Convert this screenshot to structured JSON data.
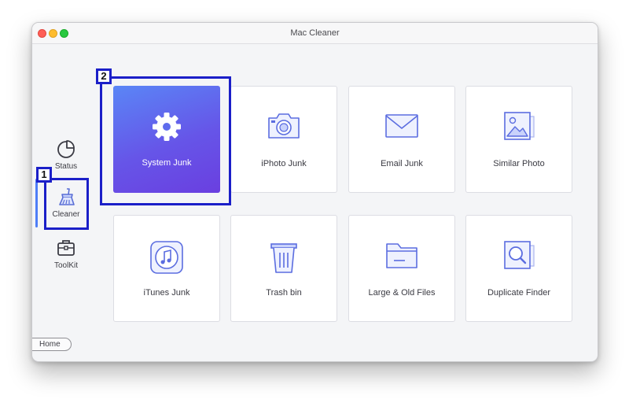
{
  "window": {
    "title": "Mac Cleaner"
  },
  "sidebar": {
    "items": [
      {
        "label": "Status",
        "icon": "pie-chart-icon"
      },
      {
        "label": "Cleaner",
        "icon": "broom-icon"
      },
      {
        "label": "ToolKit",
        "icon": "toolbox-icon"
      }
    ],
    "home_label": "Home"
  },
  "tiles": [
    {
      "label": "System Junk",
      "icon": "gear-icon"
    },
    {
      "label": "iPhoto Junk",
      "icon": "camera-icon"
    },
    {
      "label": "Email Junk",
      "icon": "envelope-icon"
    },
    {
      "label": "Similar Photo",
      "icon": "photo-icon"
    },
    {
      "label": "iTunes Junk",
      "icon": "music-icon"
    },
    {
      "label": "Trash bin",
      "icon": "trash-icon"
    },
    {
      "label": "Large & Old Files",
      "icon": "folder-icon"
    },
    {
      "label": "Duplicate Finder",
      "icon": "duplicate-search-icon"
    }
  ],
  "annotations": [
    {
      "label": "1"
    },
    {
      "label": "2"
    }
  ],
  "colors": {
    "accent": "#4f7ef7",
    "selected_gradient_start": "#5a86f6",
    "selected_gradient_end": "#6a3fe0",
    "annotation": "#1b1fc8"
  }
}
